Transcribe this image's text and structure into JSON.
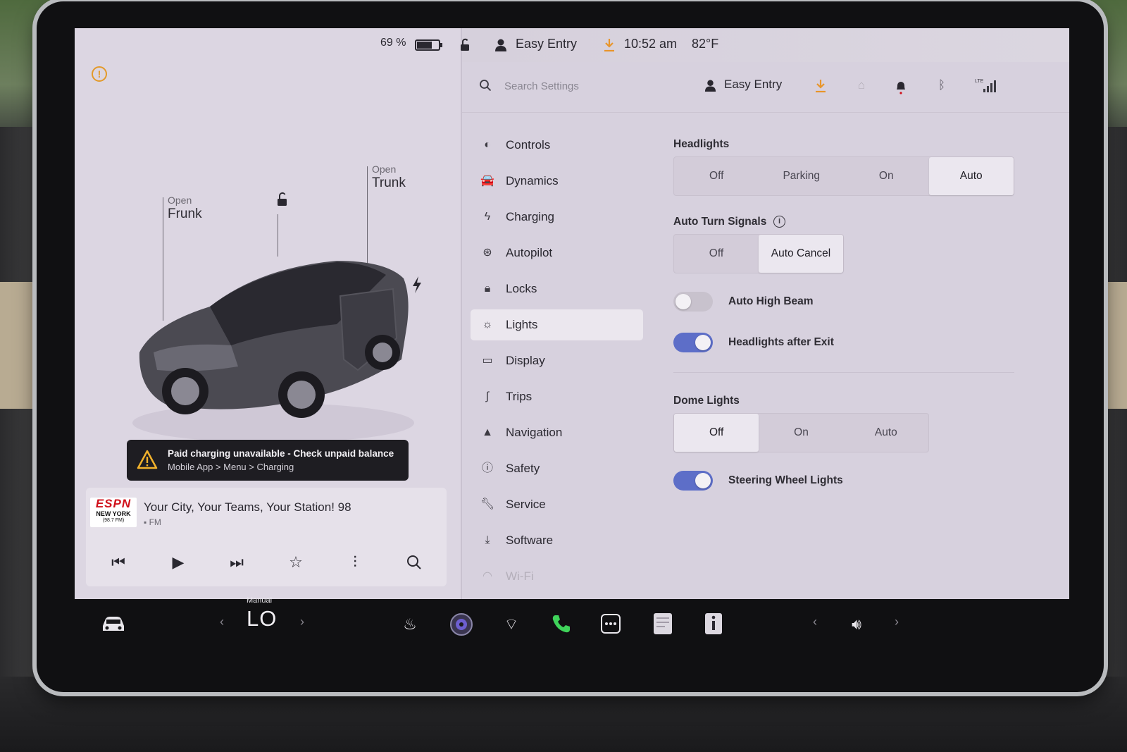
{
  "status": {
    "battery_percent": "69 %",
    "battery_level": 0.69,
    "profile": "Easy Entry",
    "time": "10:52 am",
    "temperature": "82°F"
  },
  "vehicle": {
    "frunk_action": "Open",
    "frunk_label": "Frunk",
    "trunk_action": "Open",
    "trunk_label": "Trunk"
  },
  "alert": {
    "title": "Paid charging unavailable - Check unpaid balance",
    "subtitle": "Mobile App > Menu > Charging"
  },
  "media": {
    "logo_line1": "ESPN",
    "logo_line2": "NEW YORK",
    "logo_line3": "(98.7 FM)",
    "title": "Your City, Your Teams, Your Station! 98",
    "source": "FM"
  },
  "settings_header": {
    "search_placeholder": "Search Settings",
    "profile": "Easy Entry"
  },
  "nav": {
    "items": [
      {
        "label": "Controls",
        "icon": "toggle-icon"
      },
      {
        "label": "Dynamics",
        "icon": "car-icon"
      },
      {
        "label": "Charging",
        "icon": "bolt-icon"
      },
      {
        "label": "Autopilot",
        "icon": "steering-wheel-icon"
      },
      {
        "label": "Locks",
        "icon": "lock-icon"
      },
      {
        "label": "Lights",
        "icon": "sun-icon",
        "active": true
      },
      {
        "label": "Display",
        "icon": "display-icon"
      },
      {
        "label": "Trips",
        "icon": "trips-icon"
      },
      {
        "label": "Navigation",
        "icon": "navigation-arrow-icon"
      },
      {
        "label": "Safety",
        "icon": "safety-icon"
      },
      {
        "label": "Service",
        "icon": "wrench-icon"
      },
      {
        "label": "Software",
        "icon": "download-icon"
      },
      {
        "label": "Wi-Fi",
        "icon": "wifi-icon"
      }
    ]
  },
  "lights": {
    "headlights_title": "Headlights",
    "headlights_options": [
      "Off",
      "Parking",
      "On",
      "Auto"
    ],
    "headlights_selected": "Auto",
    "turn_signals_title": "Auto Turn Signals",
    "turn_signals_options": [
      "Off",
      "Auto Cancel"
    ],
    "turn_signals_selected": "Auto Cancel",
    "auto_high_beam_label": "Auto High Beam",
    "auto_high_beam_on": false,
    "headlights_after_exit_label": "Headlights after Exit",
    "headlights_after_exit_on": true,
    "dome_title": "Dome Lights",
    "dome_options": [
      "Off",
      "On",
      "Auto"
    ],
    "dome_selected": "Off",
    "steering_wheel_label": "Steering Wheel Lights",
    "steering_wheel_on": true
  },
  "taskbar": {
    "climate_mode": "Manual",
    "climate_temp": "LO"
  },
  "colors": {
    "accent_blue": "#5d6ec8",
    "warning_orange": "#e39a2a",
    "download_orange": "#e8952a",
    "phone_green": "#3fd35a"
  }
}
